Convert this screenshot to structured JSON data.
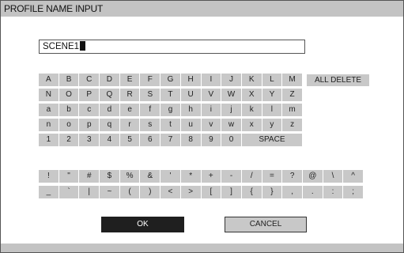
{
  "window": {
    "title": "PROFILE NAME INPUT"
  },
  "name_input": {
    "value": "SCENE1"
  },
  "keyboard": {
    "rows": [
      [
        "A",
        "B",
        "C",
        "D",
        "E",
        "F",
        "G",
        "H",
        "I",
        "J",
        "K",
        "L",
        "M"
      ],
      [
        "N",
        "O",
        "P",
        "Q",
        "R",
        "S",
        "T",
        "U",
        "V",
        "W",
        "X",
        "Y",
        "Z"
      ],
      [
        "a",
        "b",
        "c",
        "d",
        "e",
        "f",
        "g",
        "h",
        "i",
        "j",
        "k",
        "l",
        "m"
      ],
      [
        "n",
        "o",
        "p",
        "q",
        "r",
        "s",
        "t",
        "u",
        "v",
        "w",
        "x",
        "y",
        "z"
      ],
      [
        "1",
        "2",
        "3",
        "4",
        "5",
        "6",
        "7",
        "8",
        "9",
        "0",
        "SPACE"
      ]
    ],
    "all_delete_label": "ALL DELETE"
  },
  "symbols": {
    "rows": [
      [
        "!",
        "\"",
        "#",
        "$",
        "%",
        "&",
        "'",
        "*",
        "+",
        "-",
        "/",
        "=",
        "?",
        "@",
        "\\",
        "^"
      ],
      [
        "_",
        "`",
        "|",
        "~",
        "(",
        ")",
        "<",
        ">",
        "[",
        "]",
        "{",
        "}",
        ",",
        ".",
        ":",
        ";"
      ]
    ]
  },
  "buttons": {
    "ok_label": "OK",
    "cancel_label": "CANCEL"
  }
}
